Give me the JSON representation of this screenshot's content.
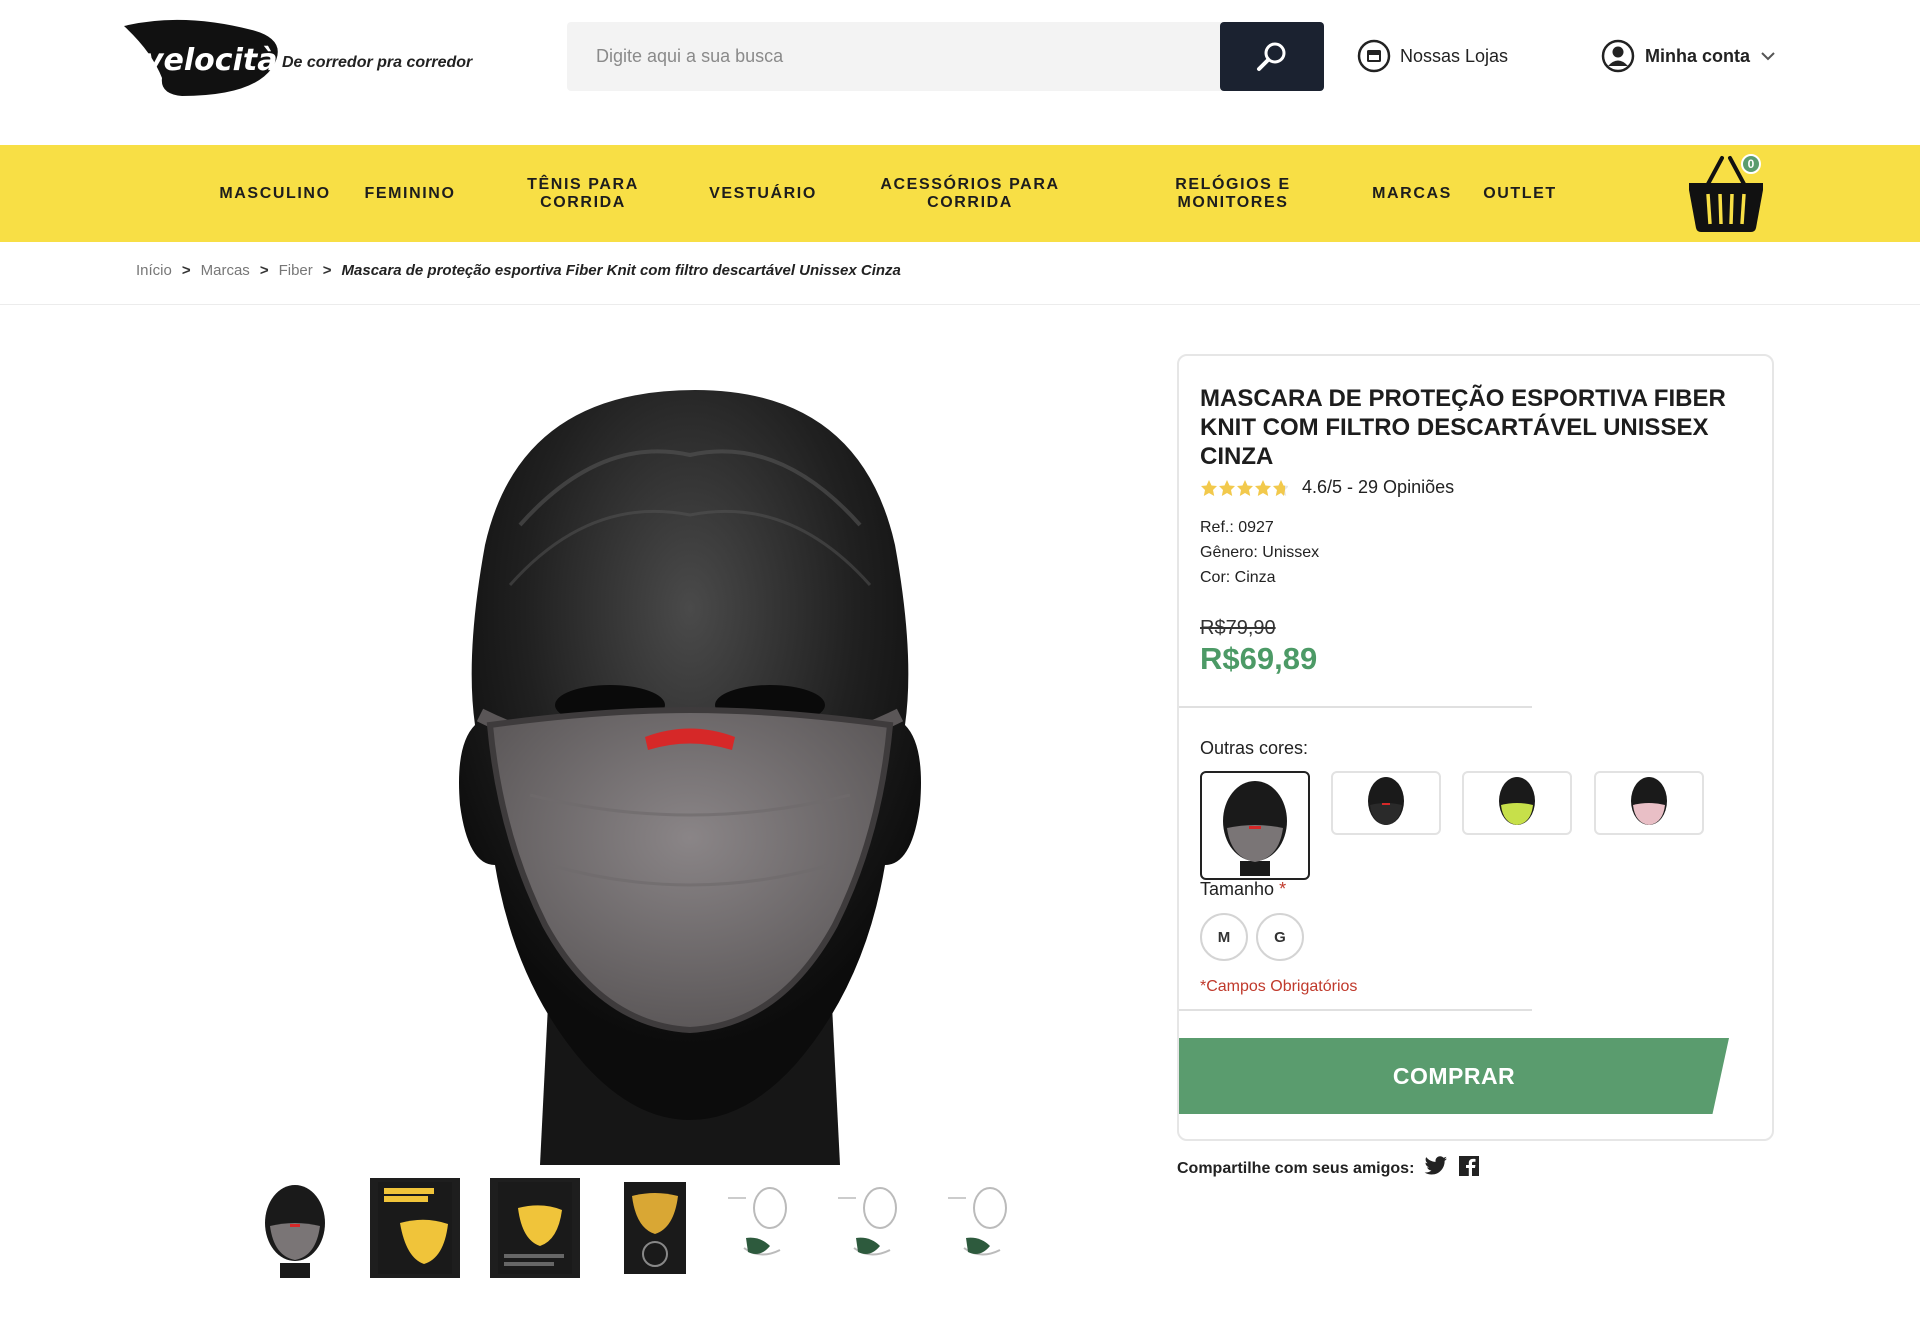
{
  "header": {
    "logo_text": "velocità",
    "tagline": "De corredor pra corredor",
    "search_placeholder": "Digite aqui a sua busca",
    "stores_label": "Nossas Lojas",
    "account_label": "Minha conta"
  },
  "nav": {
    "items": [
      {
        "label": "MASCULINO"
      },
      {
        "label": "FEMININO"
      },
      {
        "label": "TÊNIS PARA CORRIDA"
      },
      {
        "label": "VESTUÁRIO"
      },
      {
        "label": "ACESSÓRIOS PARA CORRIDA"
      },
      {
        "label": "RELÓGIOS E MONITORES"
      },
      {
        "label": "MARCAS"
      },
      {
        "label": "OUTLET"
      }
    ],
    "cart_count": "0"
  },
  "breadcrumb": {
    "items": [
      "Início",
      "Marcas",
      "Fiber"
    ],
    "separator": ">",
    "current": "Mascara de proteção esportiva Fiber Knit com filtro descartável Unissex Cinza"
  },
  "product": {
    "title": "MASCARA DE PROTEÇÃO ESPORTIVA FIBER KNIT COM FILTRO DESCARTÁVEL UNISSEX CINZA",
    "rating_text": "4.6/5 - 29 Opiniões",
    "rating_value": 4.6,
    "ref": "Ref.: 0927",
    "gender": "Gênero: Unissex",
    "color": "Cor: Cinza",
    "old_price": "R$79,90",
    "price": "R$69,89",
    "other_colors_label": "Outras cores:",
    "swatch_colors": [
      "#7a7576",
      "#3a3a3a",
      "#c7e04a",
      "#e9bfc6"
    ],
    "size_label": "Tamanho",
    "size_required_mark": "*",
    "sizes": [
      "M",
      "G"
    ],
    "required_note": "*Campos Obrigatórios",
    "buy_label": "COMPRAR",
    "share_label": "Compartilhe com seus amigos:"
  },
  "colors": {
    "nav_yellow": "#f8df45",
    "price_green": "#4c9a66",
    "buy_green": "#5a9c6e",
    "search_dark": "#1b2230"
  }
}
